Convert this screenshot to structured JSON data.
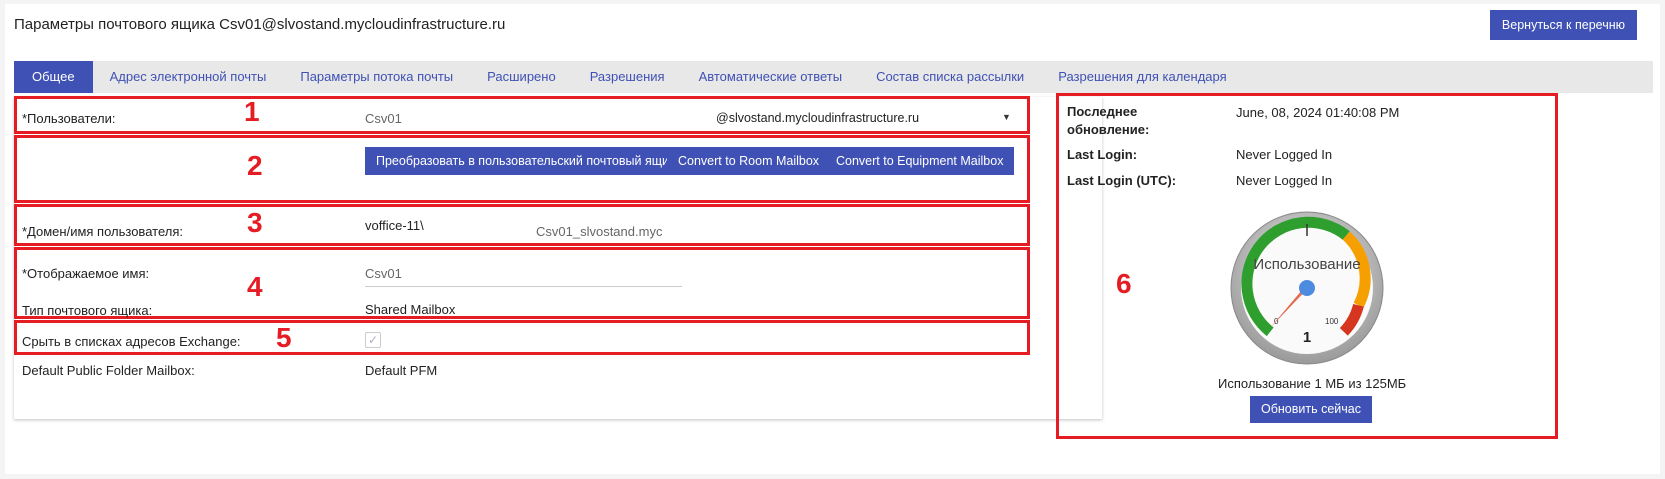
{
  "header": {
    "title": "Параметры почтового ящика Csv01@slvostand.mycloudinfrastructure.ru",
    "back_button": "Вернуться к перечню"
  },
  "tabs": [
    {
      "label": "Общее",
      "active": true
    },
    {
      "label": "Адрес электронной почты"
    },
    {
      "label": "Параметры потока почты"
    },
    {
      "label": "Расширено"
    },
    {
      "label": "Разрешения"
    },
    {
      "label": "Автоматические ответы"
    },
    {
      "label": "Состав списка рассылки"
    },
    {
      "label": "Разрешения для календаря"
    }
  ],
  "form": {
    "users_label": "*Пользователи:",
    "users_value": "Csv01",
    "domain_select": "@slvostand.mycloudinfrastructure.ru",
    "convert_user_button": "Преобразовать в пользовательский почтовый ящик",
    "convert_room_button": "Convert to Room Mailbox",
    "convert_equipment_button": "Convert to Equipment Mailbox",
    "domain_user_label": "*Домен/имя пользователя:",
    "domain_prefix": "voffice-11\\",
    "domain_user_value": "Csv01_slvostand.myc",
    "display_name_label": "*Отображаемое имя:",
    "display_name_value": "Csv01",
    "mailbox_type_label": "Тип почтового ящика:",
    "mailbox_type_value": "Shared Mailbox",
    "hide_label": "Срыть в списках адресов Exchange:",
    "hide_checked": true,
    "pfm_label": "Default Public Folder Mailbox:",
    "pfm_value": "Default PFM"
  },
  "annotations": [
    "1",
    "2",
    "3",
    "4",
    "5",
    "6"
  ],
  "side": {
    "last_update_label": "Последнее обновление:",
    "last_update_value": "June, 08, 2024 01:40:08 PM",
    "last_login_label": "Last Login:",
    "last_login_value": "Never Logged In",
    "last_login_utc_label": "Last Login (UTC):",
    "last_login_utc_value": "Never Logged In",
    "gauge": {
      "title": "Использование",
      "min_label": "0",
      "max_label": "100",
      "value": 1,
      "value_label": "1"
    },
    "usage_text": "Использование 1 МБ из 125МБ",
    "refresh_button": "Обновить сейчас"
  },
  "colors": {
    "accent": "#3f51b5",
    "annotation": "#e51c23"
  }
}
